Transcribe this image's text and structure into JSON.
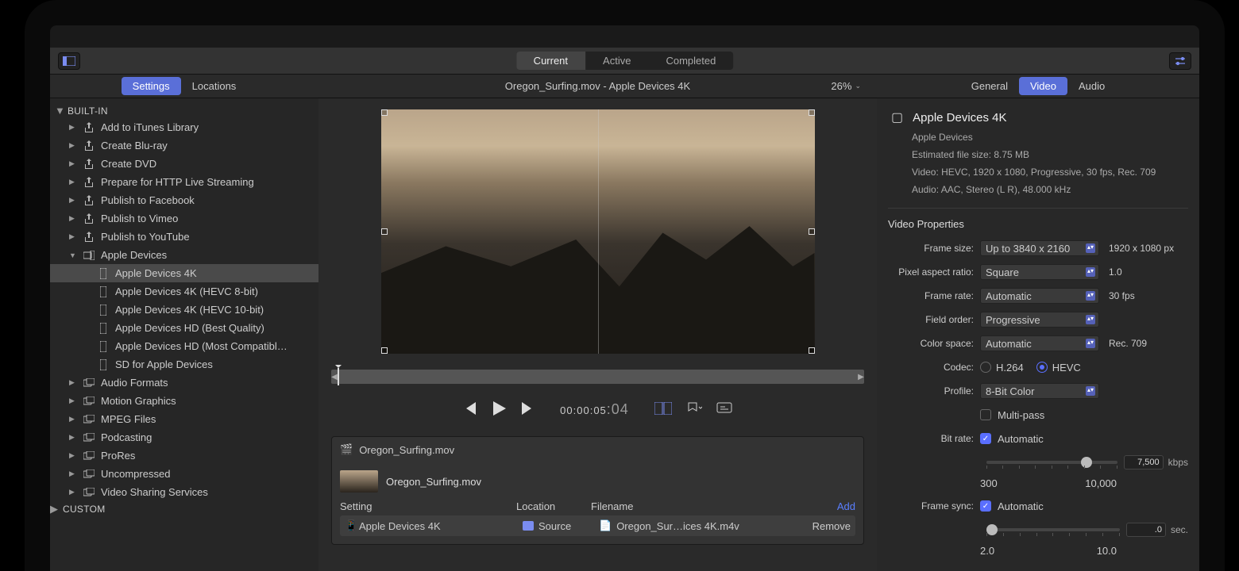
{
  "topbar": {
    "tabs": [
      "Current",
      "Active",
      "Completed"
    ],
    "active": 0
  },
  "sidebar_tabs": {
    "items": [
      "Settings",
      "Locations"
    ],
    "active": 0
  },
  "preview_title": "Oregon_Surfing.mov - Apple Devices 4K",
  "zoom": "26%",
  "inspector_tabs": {
    "items": [
      "General",
      "Video",
      "Audio"
    ],
    "active": 1
  },
  "tree": {
    "builtin": "BUILT-IN",
    "custom": "CUSTOM",
    "items": [
      "Add to iTunes Library",
      "Create Blu-ray",
      "Create DVD",
      "Prepare for HTTP Live Streaming",
      "Publish to Facebook",
      "Publish to Vimeo",
      "Publish to YouTube"
    ],
    "apple_devices": "Apple Devices",
    "apple_subs": [
      "Apple Devices 4K",
      "Apple Devices 4K (HEVC 8-bit)",
      "Apple Devices 4K (HEVC 10-bit)",
      "Apple Devices HD (Best Quality)",
      "Apple Devices HD (Most Compatibl…",
      "SD for Apple Devices"
    ],
    "apple_sel": 0,
    "rest": [
      "Audio Formats",
      "Motion Graphics",
      "MPEG Files",
      "Podcasting",
      "ProRes",
      "Uncompressed",
      "Video Sharing Services"
    ]
  },
  "timecode": {
    "main": "00:00:05",
    "frames": ":04"
  },
  "batch": {
    "file": "Oregon_Surfing.mov",
    "cols": [
      "Setting",
      "Location",
      "Filename"
    ],
    "add": "Add",
    "row": {
      "setting": "Apple Devices 4K",
      "location": "Source",
      "filename": "Oregon_Sur…ices 4K.m4v",
      "remove": "Remove"
    }
  },
  "insp": {
    "title": "Apple Devices 4K",
    "subtitle": "Apple Devices",
    "size": "Estimated file size: 8.75 MB",
    "video": "Video: HEVC, 1920 x 1080, Progressive, 30 fps, Rec. 709",
    "audio": "Audio: AAC, Stereo (L R), 48.000 kHz",
    "section": "Video Properties",
    "frame_size": {
      "lbl": "Frame size:",
      "val": "Up to 3840 x 2160",
      "note": "1920 x 1080 px"
    },
    "par": {
      "lbl": "Pixel aspect ratio:",
      "val": "Square",
      "note": "1.0"
    },
    "fr": {
      "lbl": "Frame rate:",
      "val": "Automatic",
      "note": "30 fps"
    },
    "fo": {
      "lbl": "Field order:",
      "val": "Progressive"
    },
    "cs": {
      "lbl": "Color space:",
      "val": "Automatic",
      "note": "Rec. 709"
    },
    "codec": {
      "lbl": "Codec:",
      "a": "H.264",
      "b": "HEVC"
    },
    "profile": {
      "lbl": "Profile:",
      "val": "8-Bit Color"
    },
    "multipass": "Multi-pass",
    "bitrate": {
      "lbl": "Bit rate:",
      "auto": "Automatic",
      "val": "7,500",
      "unit": "kbps",
      "min": "300",
      "max": "10,000"
    },
    "fsync": {
      "lbl": "Frame sync:",
      "auto": "Automatic",
      "val": ".0",
      "unit": "sec.",
      "min": "2.0",
      "max": "10.0"
    }
  }
}
